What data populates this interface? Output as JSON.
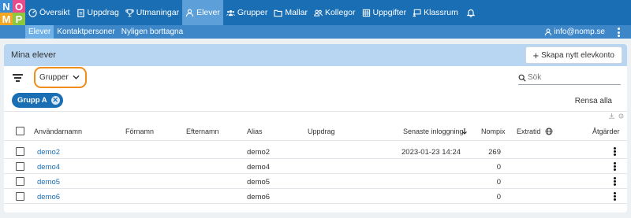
{
  "logo": {
    "letters": [
      "N",
      "O",
      "M",
      "P"
    ],
    "colors": [
      "#3b8ed6",
      "#e84c8a",
      "#f5a623",
      "#8dc63f"
    ]
  },
  "nav": {
    "items": [
      {
        "label": "Översikt",
        "icon": "dashboard-icon",
        "active": false
      },
      {
        "label": "Uppdrag",
        "icon": "assignment-icon",
        "active": false
      },
      {
        "label": "Utmaningar",
        "icon": "trophy-icon",
        "active": false
      },
      {
        "label": "Elever",
        "icon": "person-icon",
        "active": true
      },
      {
        "label": "Grupper",
        "icon": "groups-icon",
        "active": false
      },
      {
        "label": "Mallar",
        "icon": "folder-icon",
        "active": false
      },
      {
        "label": "Kollegor",
        "icon": "people-icon",
        "active": false
      },
      {
        "label": "Uppgifter",
        "icon": "grid-icon",
        "active": false
      },
      {
        "label": "Klassrum",
        "icon": "classroom-icon",
        "active": false
      }
    ],
    "bell_icon": "bell-icon"
  },
  "subnav": {
    "items": [
      {
        "label": "Elever",
        "active": true
      },
      {
        "label": "Kontaktpersoner",
        "active": false
      },
      {
        "label": "Nyligen borttagna",
        "active": false
      }
    ],
    "user": "info@nomp.se"
  },
  "card": {
    "title": "Mina elever",
    "create_button": "Skapa nytt elevkonto",
    "group_select": "Grupper",
    "search_placeholder": "Sök",
    "chip": "Grupp A",
    "clear_all": "Rensa alla"
  },
  "table": {
    "headers": {
      "username": "Användarnamn",
      "firstname": "Förnamn",
      "lastname": "Efternamn",
      "alias": "Alias",
      "assignment": "Uppdrag",
      "last_login": "Senaste inloggning",
      "nompix": "Nompix",
      "extratid": "Extratid",
      "actions": "Åtgärder"
    },
    "rows": [
      {
        "username": "demo2",
        "firstname": "",
        "lastname": "",
        "alias": "demo2",
        "assignment": "",
        "last_login": "2023-01-23 14:24",
        "nompix": "269"
      },
      {
        "username": "demo4",
        "firstname": "",
        "lastname": "",
        "alias": "demo4",
        "assignment": "",
        "last_login": "",
        "nompix": "0"
      },
      {
        "username": "demo5",
        "firstname": "",
        "lastname": "",
        "alias": "demo5",
        "assignment": "",
        "last_login": "",
        "nompix": "0"
      },
      {
        "username": "demo6",
        "firstname": "",
        "lastname": "",
        "alias": "demo6",
        "assignment": "",
        "last_login": "",
        "nompix": "0"
      }
    ]
  },
  "colors": {
    "nav": "#1a6fb4",
    "subnav": "#3d87c9",
    "highlight": "#f28c18",
    "link": "#1a6fb4"
  }
}
